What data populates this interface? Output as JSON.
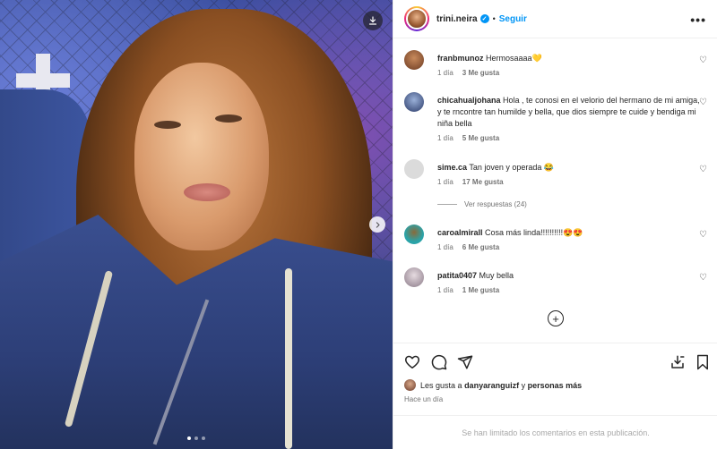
{
  "post": {
    "username": "trini.neira",
    "follow_label": "Seguir",
    "separator": "•",
    "more_label": "•••",
    "carousel_dots": 3,
    "carousel_active": 1
  },
  "comments": [
    {
      "user": "franbmunoz",
      "text": "Hermosaaaa💛",
      "time": "1 día",
      "likes": "3 Me gusta",
      "avatar_color": "#6b3a22"
    },
    {
      "user": "chicahualjohana",
      "text": "Hola , te conosi en el velorio del hermano de mi amiga, y te rncontre tan humilde y bella, que dios siempre te cuide y bendiga mi niña bella",
      "time": "1 día",
      "likes": "5 Me gusta",
      "avatar_color": "#3a4a78"
    },
    {
      "user": "sime.ca",
      "text": "Tan joven y operada 😂",
      "time": "1 día",
      "likes": "17 Me gusta",
      "avatar_color": "#d9d9d9",
      "replies_label": "Ver respuestas (24)"
    },
    {
      "user": "caroalmirall",
      "text": "Cosa más linda!!!!!!!!!!😍😍",
      "time": "1 día",
      "likes": "6 Me gusta",
      "avatar_color": "#2aa3a8"
    },
    {
      "user": "patita0407",
      "text": "Muy bella",
      "time": "1 día",
      "likes": "1 Me gusta",
      "avatar_color": "#8a7a88"
    }
  ],
  "likes_summary": {
    "prefix": "Les gusta a",
    "user": "danyaranguizf",
    "conjunction": "y",
    "others": "personas más"
  },
  "time_ago": "Hace un día",
  "footer_text": "Se han limitado los comentarios en esta publicación."
}
